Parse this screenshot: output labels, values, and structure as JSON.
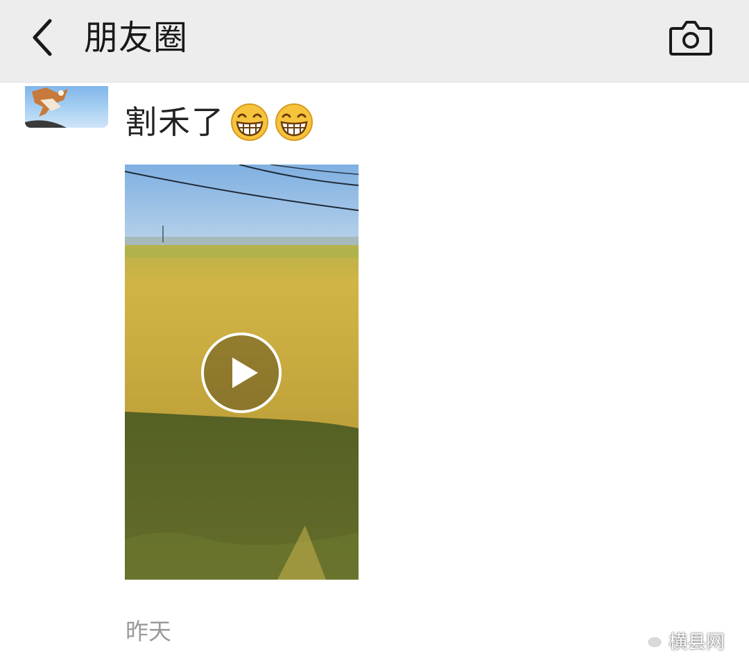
{
  "header": {
    "title": "朋友圈",
    "back_icon": "chevron-left-icon",
    "camera_icon": "camera-icon"
  },
  "post": {
    "text": "割禾了",
    "emojis": [
      "grin-emoji",
      "grin-emoji"
    ],
    "media_type": "video",
    "play_icon": "play-icon",
    "timestamp": "昨天"
  },
  "watermark": {
    "text": "横县网",
    "icon": "wechat-icon"
  },
  "colors": {
    "topbar_bg": "#ededed",
    "title": "#191919",
    "timestamp": "#9a9a9a",
    "field_gold": "#c9a83a",
    "sky": "#8bb7e3"
  }
}
